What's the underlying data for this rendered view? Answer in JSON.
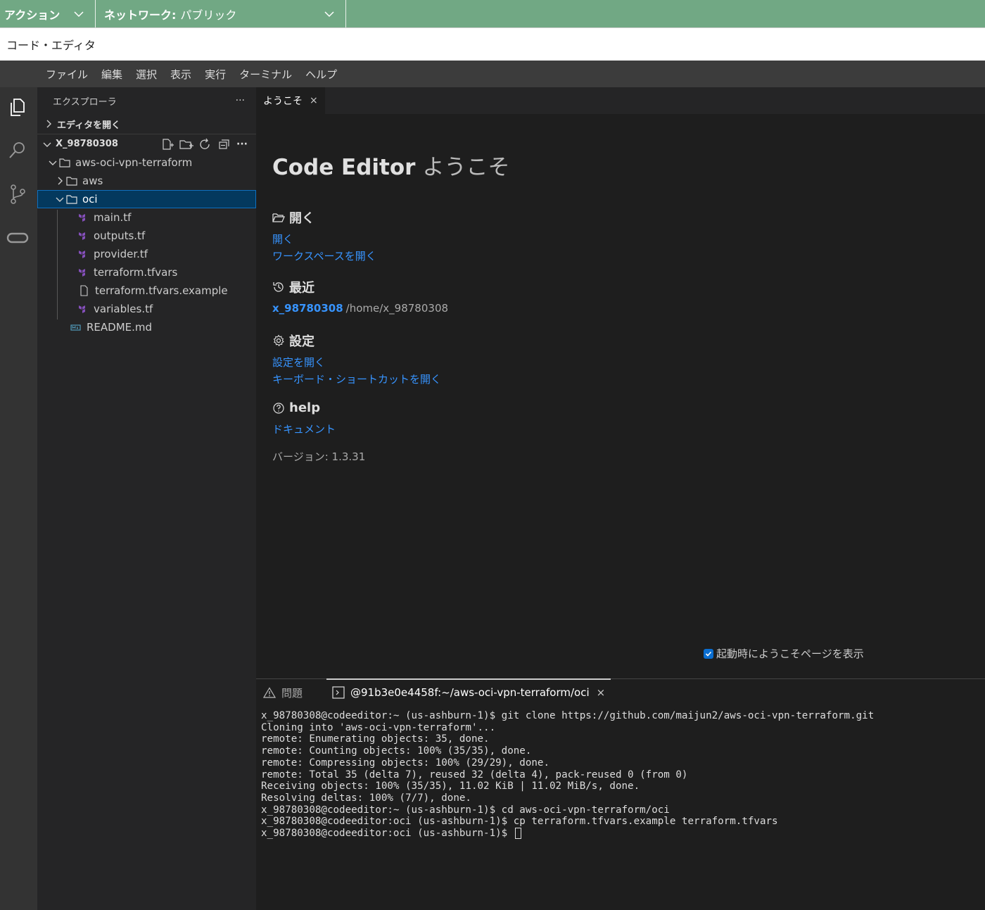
{
  "topbar": {
    "actions_label": "アクション",
    "network_label": "ネットワーク:",
    "network_value": "パブリック"
  },
  "window_title": "コード・エディタ",
  "menu": [
    "ファイル",
    "編集",
    "選択",
    "表示",
    "実行",
    "ターミナル",
    "ヘルプ"
  ],
  "activity_icons": [
    "files-icon",
    "search-icon",
    "source-control-icon",
    "oracle-icon"
  ],
  "explorer": {
    "title": "エクスプローラ",
    "more": "···",
    "open_editors": "エディタを開く",
    "workspace": "X_98780308",
    "tree": {
      "root_folder": "aws-oci-vpn-terraform",
      "aws_folder": "aws",
      "oci_folder": "oci",
      "files": [
        "main.tf",
        "outputs.tf",
        "provider.tf",
        "terraform.tfvars",
        "terraform.tfvars.example",
        "variables.tf"
      ],
      "readme": "README.md"
    }
  },
  "tab": {
    "label": "ようこそ",
    "close": "×"
  },
  "welcome": {
    "title": "Code Editor",
    "subtitle": "ようこそ",
    "open_heading": "開く",
    "open_link": "開く",
    "open_workspace_link": "ワークスペースを開く",
    "recent_heading": "最近",
    "recent_name": "x_98780308",
    "recent_path": "/home/x_98780308",
    "settings_heading": "設定",
    "settings_link": "設定を開く",
    "shortcuts_link": "キーボード・ショートカットを開く",
    "help_heading": "help",
    "docs_link": "ドキュメント",
    "version": "バージョン: 1.3.31",
    "show_on_startup": "起動時にようこそページを表示",
    "show_on_startup_checked": true
  },
  "panel": {
    "problems_tab": "問題",
    "terminal_tab": "@91b3e0e4458f:~/aws-oci-vpn-terraform/oci",
    "terminal_close": "×",
    "terminal_lines": [
      "x_98780308@codeeditor:~ (us-ashburn-1)$ git clone https://github.com/maijun2/aws-oci-vpn-terraform.git",
      "Cloning into 'aws-oci-vpn-terraform'...",
      "remote: Enumerating objects: 35, done.",
      "remote: Counting objects: 100% (35/35), done.",
      "remote: Compressing objects: 100% (29/29), done.",
      "remote: Total 35 (delta 7), reused 32 (delta 4), pack-reused 0 (from 0)",
      "Receiving objects: 100% (35/35), 11.02 KiB | 11.02 MiB/s, done.",
      "Resolving deltas: 100% (7/7), done.",
      "x_98780308@codeeditor:~ (us-ashburn-1)$ cd aws-oci-vpn-terraform/oci",
      "x_98780308@codeeditor:oci (us-ashburn-1)$ cp terraform.tfvars.example terraform.tfvars",
      "x_98780308@codeeditor:oci (us-ashburn-1)$ "
    ]
  },
  "colors": {
    "topbar": "#71a884",
    "link": "#3794ff",
    "selection": "#04395e",
    "terraform_icon": "#844fba"
  }
}
